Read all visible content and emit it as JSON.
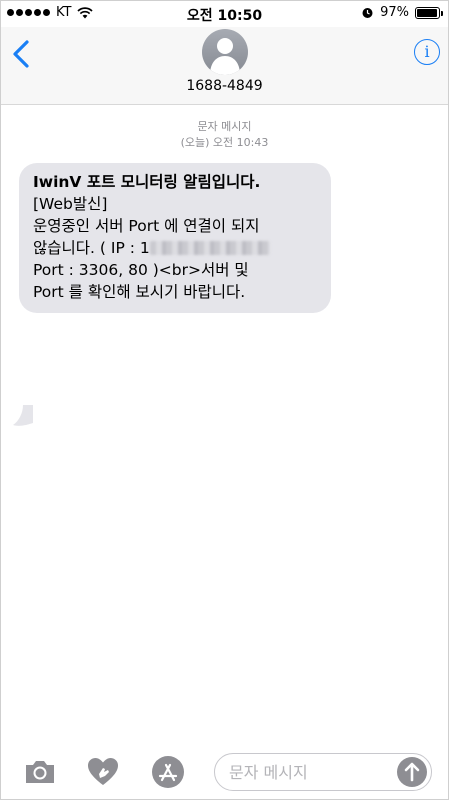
{
  "status_bar": {
    "carrier": "KT",
    "time": "오전 10:50",
    "battery_percent": "97%",
    "battery_level": 0.97
  },
  "header": {
    "contact": "1688-4849"
  },
  "conversation": {
    "type_label": "문자 메시지",
    "timestamp": "(오늘) 오전 10:43",
    "message": {
      "title": "IwinV 포트 모니터링 알림입니다.",
      "line2": "[Web발신]",
      "line3": "운영중인 서버 Port 에 연결이 되지",
      "line4_prefix": "않습니다. ( IP : 1",
      "line5": "Port : 3306, 80 )<br>서버 및",
      "line6": "Port 를 확인해 보시기 바랍니다."
    }
  },
  "toolbar": {
    "input_placeholder": "문자 메시지"
  },
  "colors": {
    "accent": "#1a7ff5",
    "bubble": "#e5e5ea",
    "meta_text": "#8e8e93"
  }
}
